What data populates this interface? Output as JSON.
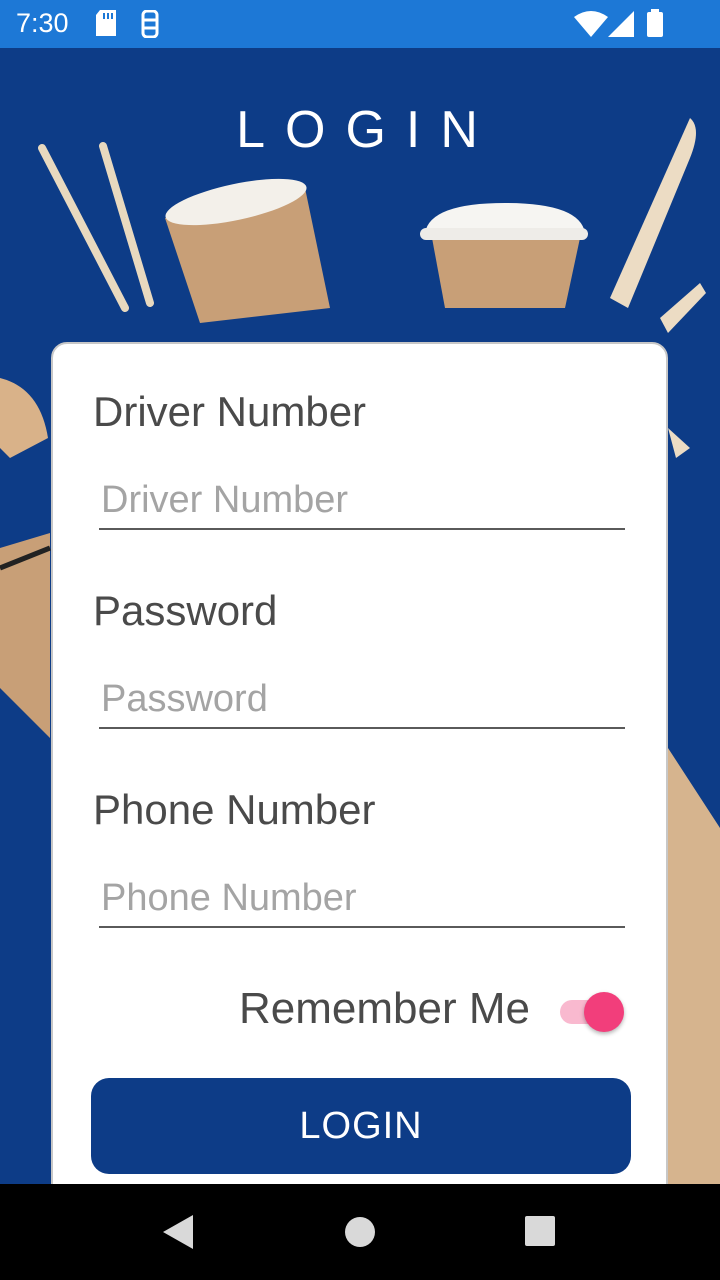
{
  "status_bar": {
    "time": "7:30",
    "icons": [
      "sd-card-icon",
      "nfc-icon",
      "wifi-icon",
      "signal-icon",
      "battery-icon"
    ]
  },
  "page": {
    "title": "LOGIN"
  },
  "form": {
    "driver_number": {
      "label": "Driver Number",
      "placeholder": "Driver Number",
      "value": ""
    },
    "password": {
      "label": "Password",
      "placeholder": "Password",
      "value": ""
    },
    "phone_number": {
      "label": "Phone Number",
      "placeholder": "Phone Number",
      "value": ""
    },
    "remember_me": {
      "label": "Remember Me",
      "checked": true
    },
    "submit_label": "LOGIN"
  },
  "nav_bar": {
    "icons": [
      "back-icon",
      "home-icon",
      "recents-icon"
    ]
  },
  "colors": {
    "status_bar": "#1d78d6",
    "background": "#0d3c87",
    "button": "#0d3c87",
    "toggle_thumb": "#f23e7b",
    "toggle_track": "#f9b9cf"
  }
}
